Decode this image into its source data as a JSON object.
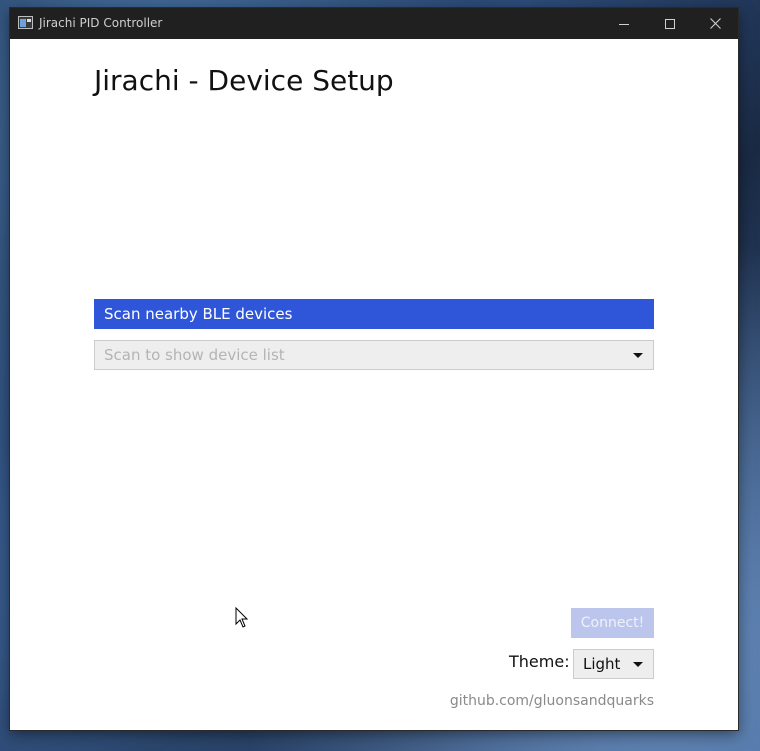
{
  "window": {
    "title": "Jirachi PID Controller",
    "controls": {
      "minimize_icon": "minimize-icon",
      "maximize_icon": "maximize-icon",
      "close_icon": "close-icon"
    }
  },
  "main": {
    "heading": "Jirachi - Device Setup",
    "scan_button_label": "Scan nearby BLE devices",
    "device_select": {
      "placeholder": "Scan to show device list",
      "selected": ""
    },
    "connect_button_label": "Connect!",
    "connect_enabled": false,
    "theme": {
      "label": "Theme:",
      "selected": "Light"
    },
    "footer_link": "github.com/gluonsandquarks"
  },
  "colors": {
    "accent": "#2f56d9",
    "accent_disabled": "#bcc6ec",
    "titlebar": "#202020",
    "background": "#ffffff"
  }
}
